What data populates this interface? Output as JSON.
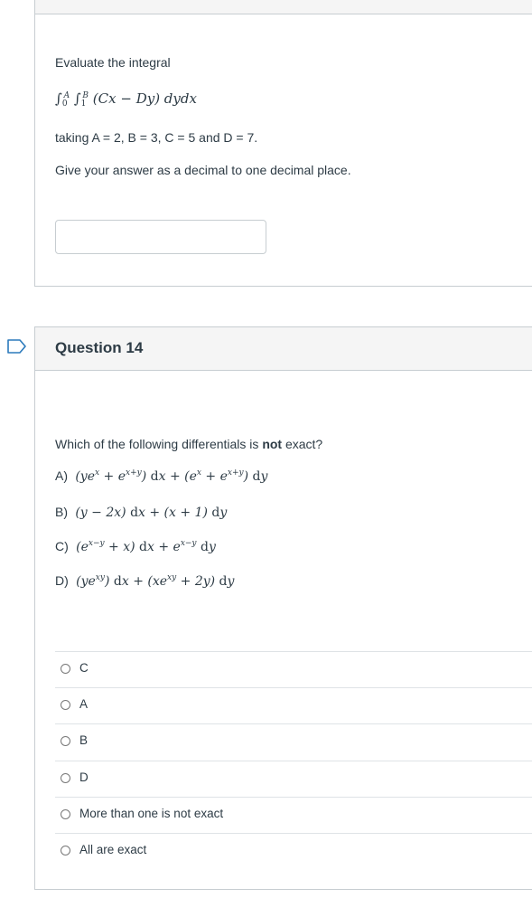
{
  "previous_question": {
    "prompt": "Evaluate the integral",
    "integral": {
      "upper_outer": "A",
      "lower_outer": "0",
      "upper_inner": "B",
      "lower_inner": "1",
      "integrand": "(Cx − Dy) dydx"
    },
    "values": "taking A = 2, B = 3, C = 5 and D = 7.",
    "instruction": "Give your answer as a decimal to one decimal place.",
    "answer_value": ""
  },
  "question14": {
    "title": "Question 14",
    "prompt_before": "Which of the following differentials is ",
    "prompt_bold": "not",
    "prompt_after": " exact?",
    "options": [
      {
        "letter": "A)"
      },
      {
        "letter": "B)"
      },
      {
        "letter": "C)"
      },
      {
        "letter": "D)"
      }
    ],
    "choices": [
      "C",
      "A",
      "B",
      "D",
      "More than one is not exact",
      "All are exact"
    ]
  },
  "icons": {
    "flag": "flag-outline-icon",
    "radio": "radio-unchecked-icon"
  },
  "colors": {
    "text": "#2d3b45",
    "border": "#c7cdd1",
    "header_bg": "#f5f5f5",
    "flag": "#2b7abc"
  }
}
